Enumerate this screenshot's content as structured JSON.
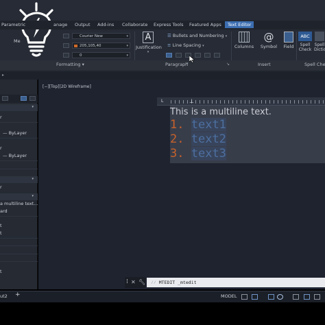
{
  "app": {
    "accent": "#3c6eb0",
    "logo": "lightbulb-icon"
  },
  "ribbon": {
    "tabs": [
      {
        "label": "Parametric"
      },
      {
        "label": "anage"
      },
      {
        "label": "Output"
      },
      {
        "label": "Add-ins"
      },
      {
        "label": "Collaborate"
      },
      {
        "label": "Express Tools"
      },
      {
        "label": "Featured Apps"
      },
      {
        "label": "Text Editor",
        "active": true
      }
    ],
    "formatting": {
      "font": "Courier New",
      "color": "205,105,40",
      "color_hex": "#cd6928",
      "oblique": "0",
      "panel_label": "Formatting ▾"
    },
    "paragraph": {
      "justification_label": "Justification",
      "bullets_label": "Bullets and Numbering",
      "line_spacing_label": "Line Spacing",
      "panel_label": "Paragraph"
    },
    "insert": {
      "columns_label": "Columns",
      "symbol_label": "Symbol",
      "field_label": "Field",
      "panel_label": "Insert"
    },
    "spell": {
      "spell_check_line1": "Spell",
      "spell_check_line2": "Check",
      "dictionaries_line1": "Spell",
      "dictionaries_line2": "Dictio",
      "panel_label": "Spell Che"
    },
    "left_partial": "Me"
  },
  "palette": {
    "rows": [
      {
        "label": "r"
      },
      {
        "label": "— ByLayer"
      },
      {
        "label": "r"
      },
      {
        "label": "— ByLayer"
      },
      {
        "label": "r"
      },
      {
        "label": "a multiline text..."
      },
      {
        "label": "ard"
      },
      {
        "label": "t"
      },
      {
        "label": "t"
      },
      {
        "label": "t"
      }
    ]
  },
  "viewport": {
    "label": "[−][Top][2D Wireframe]"
  },
  "editor": {
    "first_line": "This is a multiline text.",
    "items": [
      {
        "num": "1.",
        "text": "text1"
      },
      {
        "num": "2.",
        "text": "text2"
      },
      {
        "num": "3.",
        "text": "text3"
      }
    ]
  },
  "command": {
    "text": "MTEDIT _mtedit",
    "prompt": "⁄⁄"
  },
  "statusbar": {
    "layout_tab": "ut2",
    "add_label": "+",
    "model_label": "MODEL"
  }
}
